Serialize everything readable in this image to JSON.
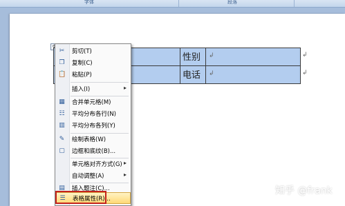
{
  "ribbon": {
    "groups": [
      "字体",
      "段落"
    ]
  },
  "table": {
    "row1_label": "性别",
    "row2_label": "电话",
    "cell_mark": "↲"
  },
  "menu": {
    "items": [
      {
        "label": "剪切(T)",
        "icon": "scissors-icon",
        "glyph": "✂"
      },
      {
        "label": "复制(C)",
        "icon": "copy-icon",
        "glyph": "❐"
      },
      {
        "label": "粘贴(P)",
        "icon": "paste-icon",
        "glyph": "📋"
      },
      {
        "label": "插入(I)",
        "icon": "",
        "glyph": "",
        "submenu": true
      },
      {
        "label": "合并单元格(M)",
        "icon": "merge-cells-icon",
        "glyph": "▦"
      },
      {
        "label": "平均分布各行(N)",
        "icon": "distribute-rows-icon",
        "glyph": "☷"
      },
      {
        "label": "平均分布各列(Y)",
        "icon": "distribute-columns-icon",
        "glyph": "▥"
      },
      {
        "label": "绘制表格(W)",
        "icon": "draw-table-icon",
        "glyph": "✎"
      },
      {
        "label": "边框和底纹(B)...",
        "icon": "borders-icon",
        "glyph": "▢"
      },
      {
        "label": "单元格对齐方式(G)",
        "icon": "",
        "glyph": "",
        "submenu": true
      },
      {
        "label": "自动调整(A)",
        "icon": "",
        "glyph": "",
        "submenu": true
      },
      {
        "label": "插入题注(C)...",
        "icon": "caption-icon",
        "glyph": "▤"
      },
      {
        "label": "表格属性(R)...",
        "icon": "table-properties-icon",
        "glyph": "☰"
      }
    ]
  },
  "watermark": "知乎 @frank"
}
